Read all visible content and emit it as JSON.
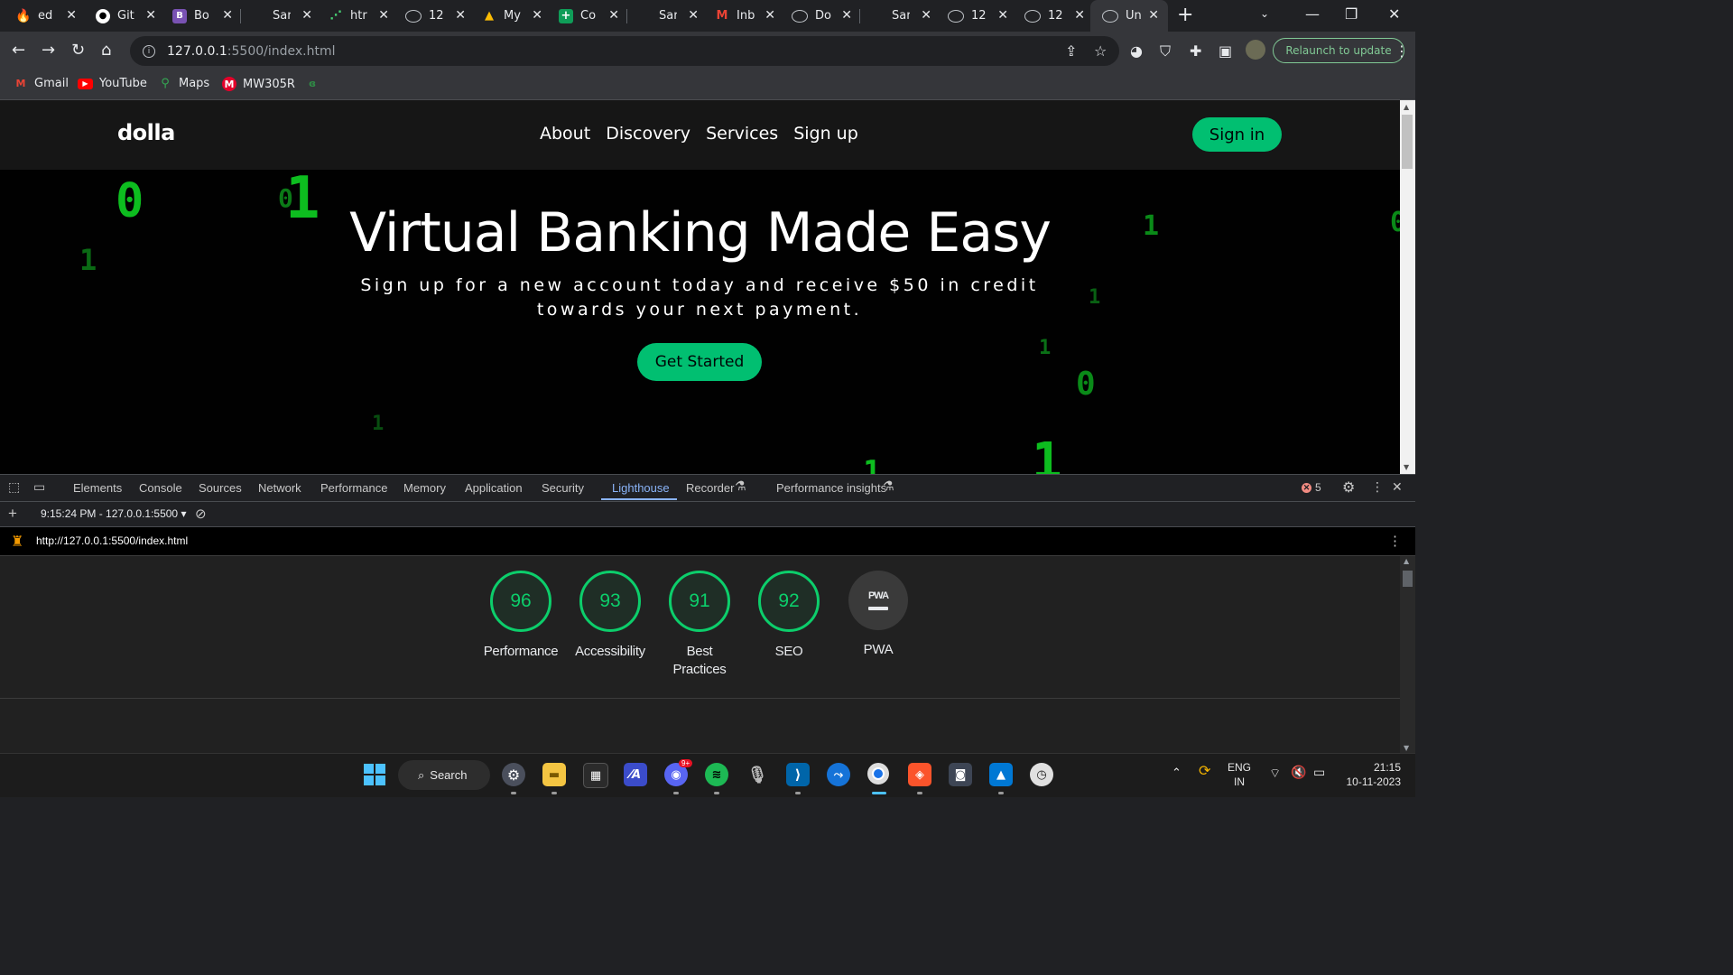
{
  "browser": {
    "tabs": [
      {
        "label": "ed",
        "icon": "flame-icon",
        "color": "#ff6d00"
      },
      {
        "label": "Git",
        "icon": "github-icon",
        "color": "#ffffff"
      },
      {
        "label": "Bo",
        "icon": "bootstrap-icon",
        "color": "#7952b3"
      },
      {
        "label": "Sar",
        "icon": "blank-icon",
        "color": "#202124"
      },
      {
        "label": "htr",
        "icon": "codepen-icon",
        "color": "#47cf73"
      },
      {
        "label": "12",
        "icon": "globe-icon",
        "color": "#9aa0a6"
      },
      {
        "label": "My",
        "icon": "drive-icon",
        "color": "#fbbc04"
      },
      {
        "label": "Co",
        "icon": "sheets-icon",
        "color": "#0f9d58"
      },
      {
        "label": "Sar",
        "icon": "blank-icon",
        "color": "#202124"
      },
      {
        "label": "Inb",
        "icon": "gmail-icon",
        "color": "#ea4335"
      },
      {
        "label": "Do",
        "icon": "globe-icon",
        "color": "#9aa0a6"
      },
      {
        "label": "Sar",
        "icon": "blank-icon",
        "color": "#202124"
      },
      {
        "label": "12",
        "icon": "globe-icon",
        "color": "#9aa0a6"
      },
      {
        "label": "12",
        "icon": "globe-icon",
        "color": "#9aa0a6"
      },
      {
        "label": "Un",
        "icon": "globe-icon",
        "color": "#9aa0a6",
        "active": true
      }
    ],
    "new_tab_symbol": "+",
    "url_host": "127.0.0.1",
    "url_path": ":5500/index.html",
    "relaunch_label": "Relaunch to update",
    "bookmarks": [
      {
        "label": "Gmail",
        "icon": "gmail-icon",
        "color": "#ea4335"
      },
      {
        "label": "YouTube",
        "icon": "youtube-icon",
        "color": "#ff0000"
      },
      {
        "label": "Maps",
        "icon": "maps-pin-icon",
        "color": "#34a853"
      },
      {
        "label": "MW305R",
        "icon": "mercusys-icon",
        "color": "#e4002b"
      }
    ]
  },
  "site": {
    "logo": "dolla",
    "menu": [
      "About",
      "Discovery",
      "Services",
      "Sign up"
    ],
    "signin_label": "Sign in",
    "hero_title": "Virtual Banking Made Easy",
    "hero_subtitle": "Sign up for a new account today and receive $50 in credit towards your next payment.",
    "cta_label": "Get Started",
    "binary_rain": [
      "0",
      "0",
      "1",
      "1",
      "1",
      "1",
      "1",
      "0",
      "1",
      "1",
      "1",
      "0"
    ],
    "accent_color": "#01bf71"
  },
  "devtools": {
    "tabs": [
      "Elements",
      "Console",
      "Sources",
      "Network",
      "Performance",
      "Memory",
      "Application",
      "Security",
      "Lighthouse",
      "Recorder",
      "Performance insights"
    ],
    "active_tab": "Lighthouse",
    "error_count": "5",
    "report_time": "9:15:24 PM - 127.0.0.1:5500",
    "report_url": "http://127.0.0.1:5500/index.html",
    "scores": [
      {
        "label": "Performance",
        "value": "96"
      },
      {
        "label": "Accessibility",
        "value": "93"
      },
      {
        "label": "Best Practices",
        "value": "91"
      },
      {
        "label": "SEO",
        "value": "92"
      },
      {
        "label": "PWA",
        "value": "PWA"
      }
    ],
    "score_color": "#0cce6b"
  },
  "taskbar": {
    "search_label": "Search",
    "language_line1": "ENG",
    "language_line2": "IN",
    "time": "21:15",
    "date": "10-11-2023",
    "discord_badge": "9+"
  }
}
